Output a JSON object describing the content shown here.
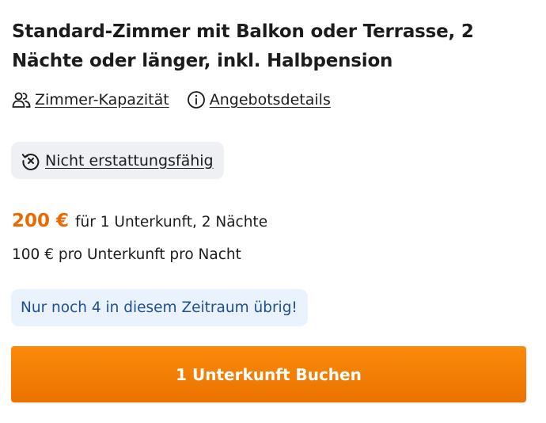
{
  "offer": {
    "title": "Standard-Zimmer mit Balkon oder Terrasse, 2 Nächte oder länger, inkl. Halbpension"
  },
  "links": {
    "capacity": {
      "label": "Zimmer-Kapazität",
      "icon": "users-icon"
    },
    "details": {
      "label": "Angebotsdetails",
      "icon": "info-icon"
    }
  },
  "policy": {
    "label": "Nicht erstattungsfähig",
    "icon": "non-refundable-icon"
  },
  "price": {
    "amount": "200 €",
    "description": "für 1 Unterkunft, 2 Nächte",
    "per_night": "100 € pro Unterkunft pro Nacht"
  },
  "availability": {
    "text": "Nur noch 4 in diesem Zeitraum übrig!"
  },
  "book": {
    "label": "1 Unterkunft Buchen"
  },
  "colors": {
    "accent": "#e86a00",
    "button": "#f57f00",
    "availability_bg": "#eaf3fd",
    "availability_text": "#1e4f8f",
    "badge_bg": "#eef0f4"
  }
}
